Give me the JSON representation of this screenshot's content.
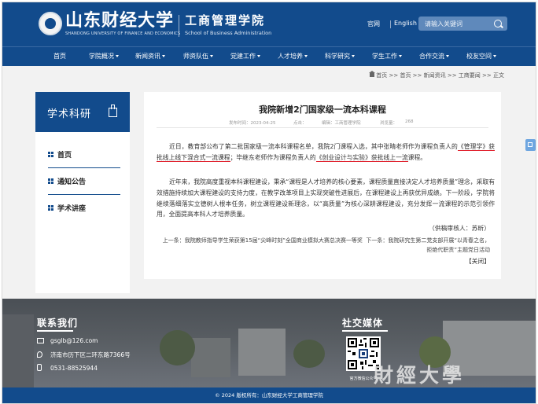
{
  "header": {
    "logo_cn": "山东财经大学",
    "logo_en": "SHANDONG UNIVERSITY OF FINANCE AND ECONOMICS",
    "school_cn": "工商管理学院",
    "school_en": "School of Business Administration",
    "links": [
      "官网",
      "English"
    ],
    "search_placeholder": "请输入关键词"
  },
  "nav": {
    "items": [
      {
        "label": "首页",
        "dropdown": false
      },
      {
        "label": "学院概况",
        "dropdown": true
      },
      {
        "label": "新闻资讯",
        "dropdown": true
      },
      {
        "label": "师资队伍",
        "dropdown": true
      },
      {
        "label": "党建工作",
        "dropdown": true
      },
      {
        "label": "人才培养",
        "dropdown": true
      },
      {
        "label": "科学研究",
        "dropdown": true
      },
      {
        "label": "学生工作",
        "dropdown": true
      },
      {
        "label": "合作交流",
        "dropdown": true
      },
      {
        "label": "校友空间",
        "dropdown": true
      }
    ]
  },
  "breadcrumb": "首页 >> 首页 >> 新闻资讯 >> 工商要闻 >> 正文",
  "sidebar": {
    "title": "学术科研",
    "items": [
      {
        "label": "首页",
        "active": true
      },
      {
        "label": "通知公告",
        "active": false
      },
      {
        "label": "学术讲座",
        "active": false
      }
    ]
  },
  "article": {
    "title": "我院新增2门国家级一流本科课程",
    "meta": {
      "date": "发布时间：2023-04-25",
      "clicks": "点击：",
      "editor": "编辑：工商管理学院",
      "views_label": "浏览量：",
      "views": "268"
    },
    "p1_a": "近日，教育部公布了第二批国家级一流本科课程名单，我院2门课程入选，其中张晴老师作为课程负责人的",
    "p1_u1": "《管理学》获批线上线下混合式一流课程",
    "p1_b": "；毕继东老师作为课程负责人的",
    "p1_u2": "《创业设计与实验》获批线上一流",
    "p1_c": "课程。",
    "p2": "近年来，我院高度重视本科课程建设，秉承“课程是人才培养的核心要素，课程质量直接决定人才培养质量”理念，采取有效措施持续加大课程建设的支持力度，在教学改革项目上实现突破性进展后，在课程建设上再获优异成绩。下一阶段，学院将继续落细落实立德树人根本任务，树立课程建设新理念，以“高质量”为核心深耕课程建设，充分发挥一流课程的示范引领作用，全面提高本科人才培养质量。",
    "signature": "（供稿审核人：苏昕）",
    "prev": "上一条：我院教师指导学生荣获第15届“尖峰时刻”全国商业模拟大赛总决赛一等奖",
    "next": "下一条：我院研究生第二党支部开展“以青春之名，拒绝代职责”主题党日活动",
    "close": "【关闭】"
  },
  "footer": {
    "contact_title": "联系我们",
    "email": "gsglb@126.com",
    "address": "济南市历下区二环东路7366号",
    "phone": "0531-88525944",
    "social_title": "社交媒体",
    "qr_caption": "官方微信公众号",
    "copyright": "© 2024 版权所有：山东财经大学工商管理学院"
  },
  "colors": {
    "primary": "#124b8c",
    "highlight": "#e0202c"
  }
}
